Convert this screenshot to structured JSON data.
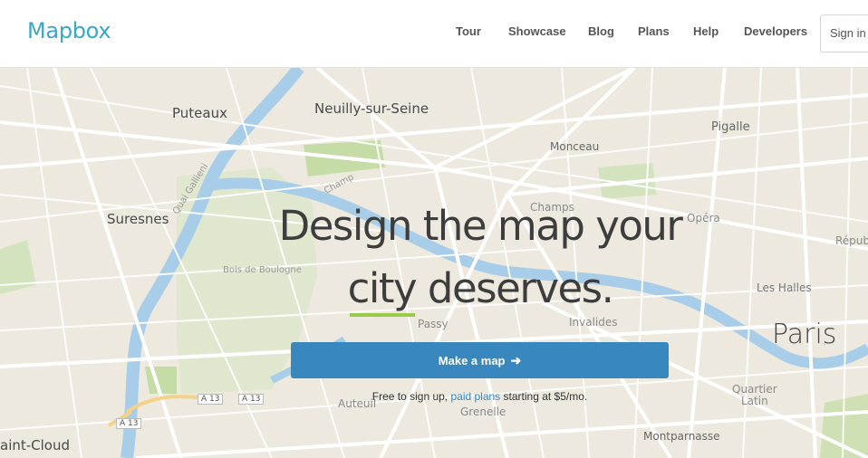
{
  "header": {
    "logo": "Mapbox",
    "nav": [
      "Tour",
      "Showcase",
      "Blog",
      "Plans",
      "Help",
      "Developers"
    ],
    "sign_in": "Sign in"
  },
  "hero": {
    "line1": "Design the map your",
    "line2": "city deserves.",
    "cta_label": "Make a map",
    "cta_arrow_icon": "arrow-right-icon",
    "signup_prefix": "Free to sign up, ",
    "signup_link": "paid plans",
    "signup_suffix": " starting at $5/mo.",
    "accent_color": "#3887be",
    "underline_color": "#9bc94a"
  },
  "map": {
    "places": {
      "puteaux": "Puteaux",
      "neuilly": "Neuilly-sur-Seine",
      "pigalle": "Pigalle",
      "monceau": "Monceau",
      "suresnes": "Suresnes",
      "champs": "Champs",
      "opera": "Opéra",
      "republique": "Républ",
      "bois": "Bois de Boulogne",
      "les_halles": "Les Halles",
      "passy": "Passy",
      "invalides": "Invalides",
      "paris": "Paris",
      "auteuil": "Auteuil",
      "grenelle": "Grenelle",
      "quartier_latin_1": "Quartier",
      "quartier_latin_2": "Latin",
      "saint_cloud": "aint-Cloud",
      "montparnasse": "Montparnasse",
      "quai": "Quai Gallieni",
      "champ": "Champ"
    },
    "shields": [
      "A 13",
      "A 13",
      "A 13"
    ]
  }
}
